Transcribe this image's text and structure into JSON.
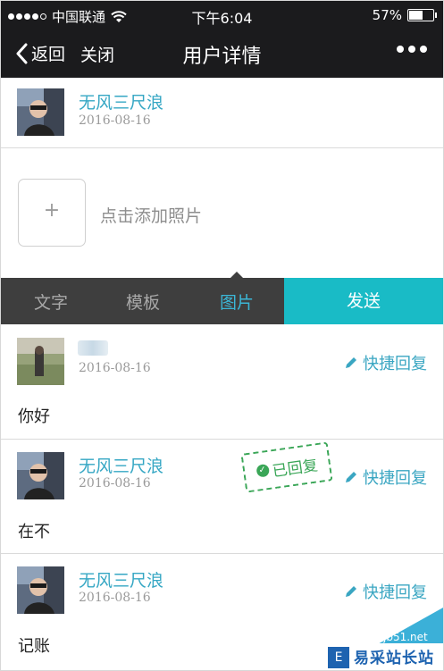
{
  "status_bar": {
    "carrier": "中国联通",
    "time": "下午6:04",
    "battery": "57%",
    "battery_level": 0.57
  },
  "nav": {
    "back_label": "返回",
    "close_label": "关闭",
    "title": "用户详情"
  },
  "profile": {
    "name": "无风三尺浪",
    "date": "2016-08-16"
  },
  "composer": {
    "add_plus": "+",
    "add_photo_label": "点击添加照片"
  },
  "tabs": {
    "items": [
      {
        "label": "文字"
      },
      {
        "label": "模板"
      },
      {
        "label": "图片"
      }
    ],
    "active": "图片",
    "send_label": "发送"
  },
  "messages": [
    {
      "name": "",
      "date": "2016-08-16",
      "text": "你好",
      "reply_label": "快捷回复"
    },
    {
      "name": "无风三尺浪",
      "date": "2016-08-16",
      "text": "在不",
      "reply_label": "快捷回复",
      "stamp": "已回复"
    },
    {
      "name": "无风三尺浪",
      "date": "2016-08-16",
      "text": "记账",
      "reply_label": "快捷回复"
    }
  ],
  "watermark": {
    "url": "jb51.net",
    "logo_text": "易采站长站",
    "logo_mark": "E"
  },
  "colors": {
    "accent": "#36a7c4",
    "send": "#19bbc6",
    "stamp": "#3aa657",
    "bar": "#1b1b1d"
  }
}
